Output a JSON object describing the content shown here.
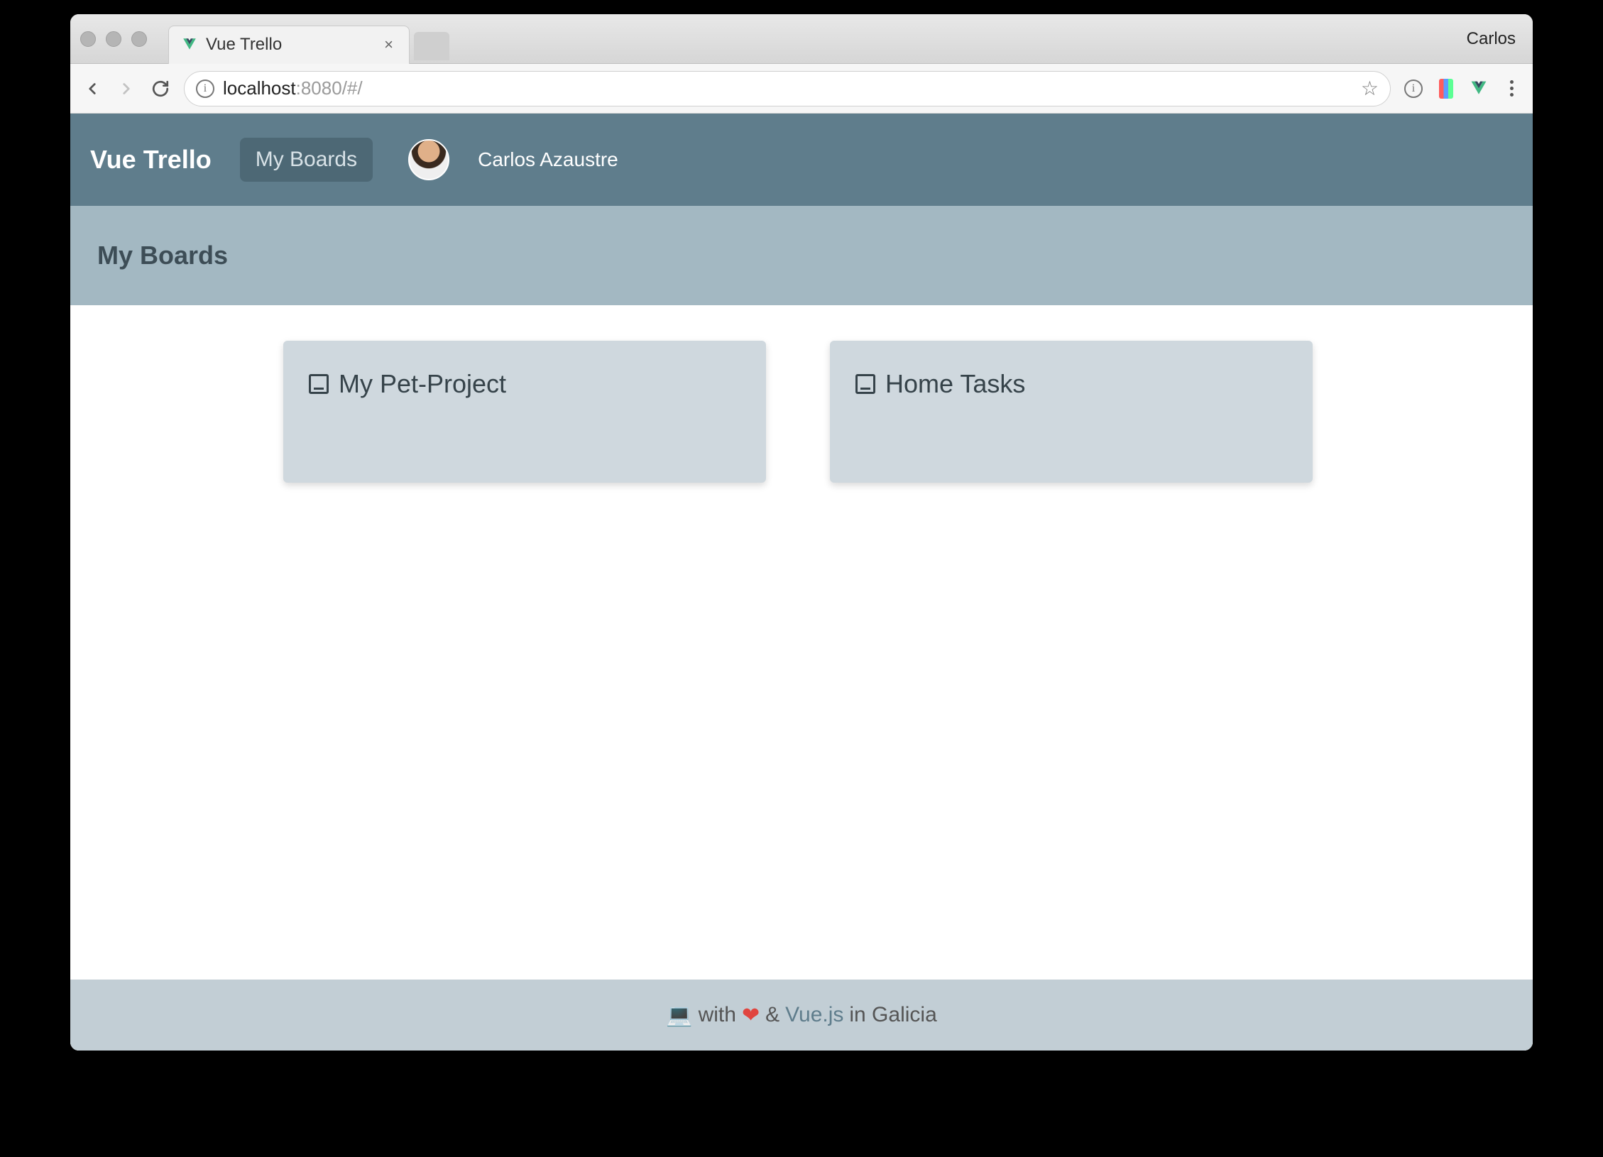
{
  "browser": {
    "tab_title": "Vue Trello",
    "profile_name": "Carlos",
    "url_host": "localhost",
    "url_rest": ":8080/#/"
  },
  "app": {
    "brand": "Vue Trello",
    "nav_my_boards": "My Boards",
    "user_name": "Carlos Azaustre",
    "subheader_title": "My Boards",
    "boards": [
      {
        "title": "My Pet-Project"
      },
      {
        "title": "Home Tasks"
      }
    ],
    "footer": {
      "with": "with",
      "amp": "&",
      "vue_link": "Vue.js",
      "location": "in Galicia"
    }
  }
}
